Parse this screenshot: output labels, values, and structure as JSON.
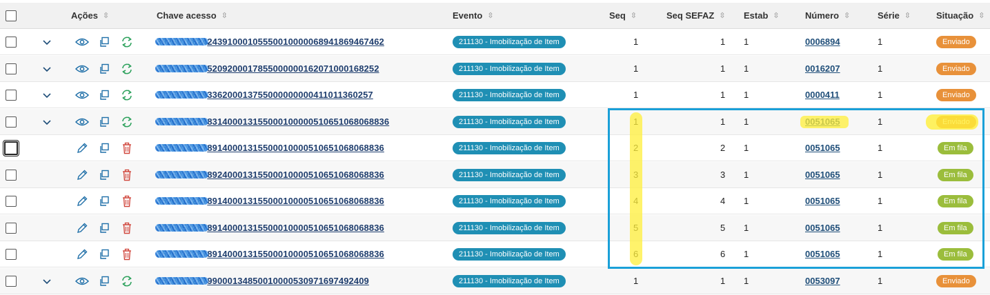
{
  "header": {
    "acoes": "Ações",
    "chave": "Chave acesso",
    "evento": "Evento",
    "seq": "Seq",
    "seq_sefaz": "Seq SEFAZ",
    "estab": "Estab",
    "numero": "Número",
    "serie": "Série",
    "situacao": "Situação",
    "sort_glyph": "⇳"
  },
  "rows": [
    {
      "key_hidden": "3926010824",
      "key": "24391000105550010000068941869467462",
      "evento": "211130 - Imobilização de Item",
      "seq": "1",
      "seq_sefaz": "1",
      "estab": "1",
      "numero": "0006894",
      "serie": "1",
      "situacao": "Enviado",
      "kind": "sent"
    },
    {
      "key_hidden": "3426015990",
      "key": "5209200017855000000162071000168252",
      "evento": "211130 - Imobilização de Item",
      "seq": "1",
      "seq_sefaz": "1",
      "estab": "1",
      "numero": "0016207",
      "serie": "1",
      "situacao": "Enviado",
      "kind": "sent"
    },
    {
      "key_hidden": "3126016689",
      "key": "336200013755000000000411011360257",
      "evento": "211130 - Imobilização de Item",
      "seq": "1",
      "seq_sefaz": "1",
      "estab": "1",
      "numero": "0000411",
      "serie": "1",
      "situacao": "Enviado",
      "kind": "sent"
    },
    {
      "key_hidden": "3526014287",
      "key": "831400013155000100000510651068068836",
      "evento": "211130 - Imobilização de Item",
      "seq": "1",
      "seq_sefaz": "1",
      "estab": "1",
      "numero": "0051065",
      "serie": "1",
      "situacao": "Enviado",
      "kind": "sent"
    },
    {
      "key_hidden": "3526014287",
      "key": "89140001315500010000510651068068836",
      "evento": "211130 - Imobilização de Item",
      "seq": "2",
      "seq_sefaz": "2",
      "estab": "1",
      "numero": "0051065",
      "serie": "1",
      "situacao": "Em fila",
      "kind": "queued"
    },
    {
      "key_hidden": "3426014287",
      "key": "89240001315500010000510651068068836",
      "evento": "211130 - Imobilização de Item",
      "seq": "3",
      "seq_sefaz": "3",
      "estab": "1",
      "numero": "0051065",
      "serie": "1",
      "situacao": "Em fila",
      "kind": "queued"
    },
    {
      "key_hidden": "3526014287",
      "key": "89140001315500010000510651068068836",
      "evento": "211130 - Imobilização de Item",
      "seq": "4",
      "seq_sefaz": "4",
      "estab": "1",
      "numero": "0051065",
      "serie": "1",
      "situacao": "Em fila",
      "kind": "queued"
    },
    {
      "key_hidden": "3926054287",
      "key": "89140001315500010000510651068068836",
      "evento": "211130 - Imobilização de Item",
      "seq": "5",
      "seq_sefaz": "5",
      "estab": "1",
      "numero": "0051065",
      "serie": "1",
      "situacao": "Em fila",
      "kind": "queued"
    },
    {
      "key_hidden": "3526014287",
      "key": "89140001315500010000510651068068836",
      "evento": "211130 - Imobilização de Item",
      "seq": "6",
      "seq_sefaz": "6",
      "estab": "1",
      "numero": "0051065",
      "serie": "1",
      "situacao": "Em fila",
      "kind": "queued"
    },
    {
      "key_hidden": "3526014287",
      "key": "99000134850010000530971697492409",
      "evento": "211130 - Imobilização de Item",
      "seq": "1",
      "seq_sefaz": "1",
      "estab": "1",
      "numero": "0053097",
      "serie": "1",
      "situacao": "Enviado",
      "kind": "sent"
    }
  ],
  "colors": {
    "accent": "#1f8fb4",
    "sent": "#e8913a",
    "queued": "#9bbd3c",
    "highlight_box": "#1aa0d8",
    "marker": "#ffef3a"
  },
  "icons": {
    "expand": "chevron-down-icon",
    "view": "eye-icon",
    "copy": "copy-icon",
    "resend": "refresh-icon",
    "edit": "pencil-icon",
    "delete": "trash-icon"
  }
}
